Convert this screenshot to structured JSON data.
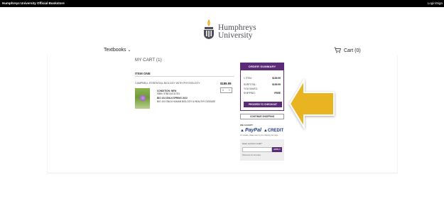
{
  "topbar": {
    "store_name": "Humphreys University Official Bookstore",
    "login": "Login/Sign"
  },
  "logo": {
    "line1": "Humphreys",
    "line2": "University"
  },
  "nav": {
    "textbooks": "Textbooks",
    "cart": "Cart (0)"
  },
  "cart": {
    "title": "MY CART (1)",
    "item_heading": "ITEM ONE",
    "item": {
      "title": "CAMPBELL ESSENTIAL BIOLOGY WITH PHYSIOLOGY",
      "price": "$189.99",
      "quantity": "1",
      "condition": "CONDITION: NEW",
      "isbn": "ISBN: 9780134711751",
      "shipping_line1": "BIO 104 ONLN SPRING 2022",
      "shipping_line2": "BIO 104 ONLN HUMAN BIOLOGY & HEALTHY DISEASE"
    }
  },
  "summary": {
    "heading": "ORDER SUMMARY",
    "rows": [
      {
        "label": "1 ITEM:",
        "value": "$189.99"
      },
      {
        "label": "SUBTOTAL:",
        "value": "$189.99"
      },
      {
        "label": "YOU SAVED:",
        "value": ""
      },
      {
        "label": "SHIPPING:",
        "value": "FREE"
      }
    ],
    "checkout_button": "PROCEED TO CHECKOUT"
  },
  "continue_button": "CONTINUE SHOPPING",
  "payments": {
    "we_accept": "WE ACCEPT",
    "paypal": "PayPal",
    "credit": "CREDIT",
    "note": "For details, please refer to your shipping cart page."
  },
  "promo": {
    "label": "Have a promo code?",
    "apply_button": "APPLY",
    "hint": "Discounts for all codes"
  },
  "colors": {
    "brand_purple": "#5b2b78",
    "arrow_gold": "#e8b420"
  }
}
